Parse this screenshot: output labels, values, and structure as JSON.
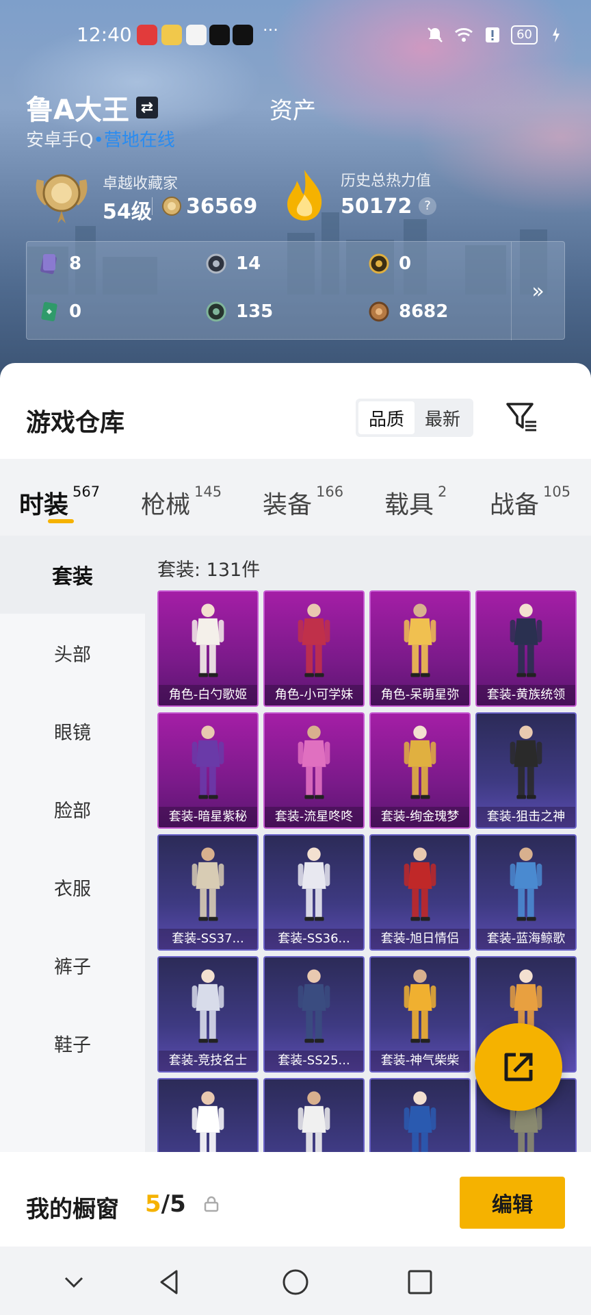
{
  "status_bar": {
    "time": "12:40",
    "more": "···",
    "battery": "60"
  },
  "profile": {
    "name": "鲁A大王",
    "asset_tab": "资产",
    "platform": "安卓手Q",
    "online_status": "营地在线",
    "collector_title": "卓越收藏家",
    "level": "54级",
    "collector_points": "36569",
    "heat_label": "历史总热力值",
    "heat_value": "50172",
    "help": "?"
  },
  "assets": {
    "items": [
      {
        "value": "8",
        "icon": "purple-card-icon"
      },
      {
        "value": "14",
        "icon": "silver-coin-icon"
      },
      {
        "value": "0",
        "icon": "gold-coin-icon"
      },
      {
        "value": "0",
        "icon": "green-ticket-icon"
      },
      {
        "value": "135",
        "icon": "green-coin-icon"
      },
      {
        "value": "8682",
        "icon": "bronze-coin-icon"
      }
    ],
    "more": "»"
  },
  "warehouse": {
    "title": "游戏仓库",
    "sort_options": [
      "品质",
      "最新"
    ],
    "sort_selected": "品质"
  },
  "category_tabs": [
    {
      "label": "时装",
      "count": "567"
    },
    {
      "label": "枪械",
      "count": "145"
    },
    {
      "label": "装备",
      "count": "166"
    },
    {
      "label": "载具",
      "count": "2"
    },
    {
      "label": "战备",
      "count": "105"
    }
  ],
  "sidebar": [
    "套装",
    "头部",
    "眼镜",
    "脸部",
    "衣服",
    "裤子",
    "鞋子"
  ],
  "content": {
    "count_text": "套装: 131件",
    "items": [
      {
        "label": "角色-白勺歌姬",
        "rarity": "purple"
      },
      {
        "label": "角色-小可学妹",
        "rarity": "purple"
      },
      {
        "label": "角色-呆萌星弥",
        "rarity": "purple"
      },
      {
        "label": "套装-黄族统领",
        "rarity": "purple"
      },
      {
        "label": "套装-暗星紫秘",
        "rarity": "purple"
      },
      {
        "label": "套装-流星咚咚",
        "rarity": "purple"
      },
      {
        "label": "套装-绚金瑰梦",
        "rarity": "purple"
      },
      {
        "label": "套装-狙击之神",
        "rarity": "blue"
      },
      {
        "label": "套装-SS37...",
        "rarity": "blue"
      },
      {
        "label": "套装-SS36...",
        "rarity": "blue"
      },
      {
        "label": "套装-旭日情侣",
        "rarity": "blue"
      },
      {
        "label": "套装-蓝海鲸歌",
        "rarity": "blue"
      },
      {
        "label": "套装-竞技名士",
        "rarity": "blue"
      },
      {
        "label": "套装-SS25...",
        "rarity": "blue"
      },
      {
        "label": "套装-神气柴柴",
        "rarity": "blue"
      },
      {
        "label": "",
        "rarity": "blue"
      },
      {
        "label": "",
        "rarity": "blue"
      },
      {
        "label": "",
        "rarity": "blue"
      },
      {
        "label": "",
        "rarity": "blue"
      },
      {
        "label": "",
        "rarity": "blue"
      }
    ]
  },
  "showcase": {
    "title": "我的橱窗",
    "used": "5",
    "total": "/5",
    "edit_label": "编辑"
  },
  "colors": {
    "accent": "#f5b200",
    "online": "#2a8cf0",
    "purple_card": "#a41ea6",
    "blue_card": "#3e3a82"
  }
}
